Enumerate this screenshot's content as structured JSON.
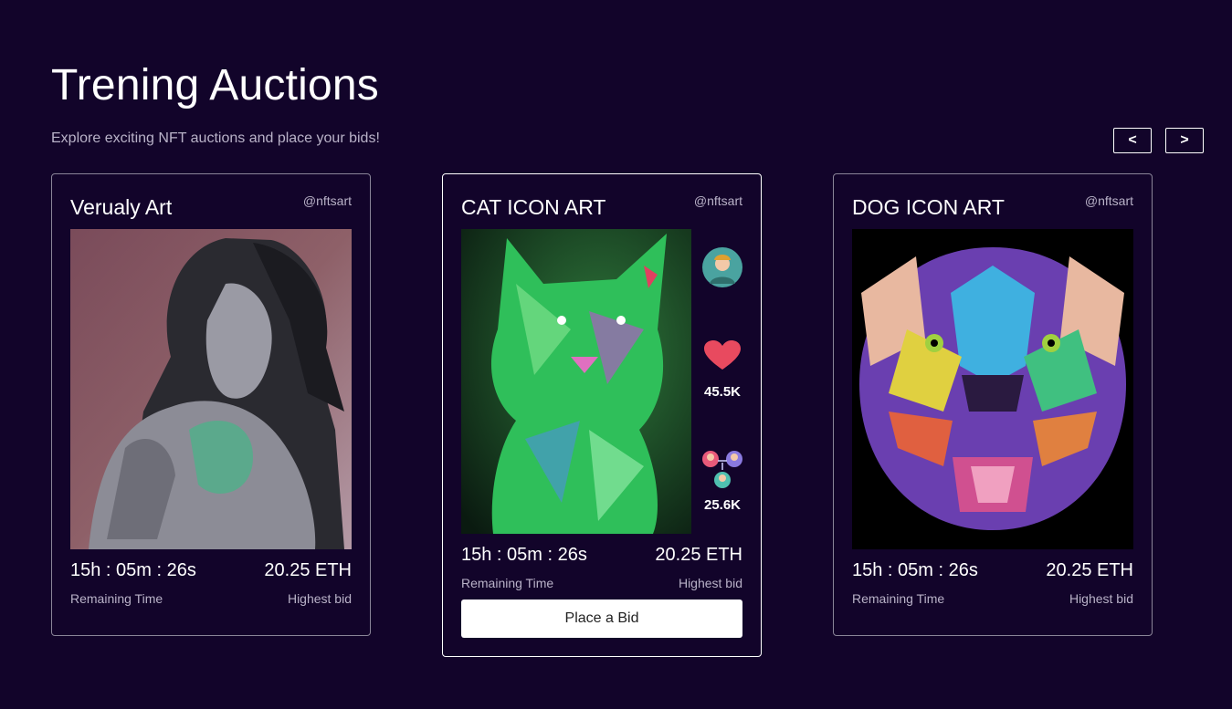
{
  "header": {
    "title": "Trening Auctions",
    "subtitle": "Explore exciting NFT auctions and place your bids!"
  },
  "nav": {
    "prev_label": "<",
    "next_label": ">"
  },
  "cards": [
    {
      "title": "Verualy Art",
      "handle": "@nftsart",
      "time": "15h : 05m : 26s",
      "bid": "20.25 ETH",
      "time_label": "Remaining Time",
      "bid_label": "Highest bid"
    },
    {
      "title": "CAT ICON ART",
      "handle": "@nftsart",
      "time": "15h : 05m : 26s",
      "bid": "20.25 ETH",
      "time_label": "Remaining Time",
      "bid_label": "Highest bid",
      "likes": "45.5K",
      "owners": "25.6K",
      "button": "Place a Bid"
    },
    {
      "title": "DOG ICON ART",
      "handle": "@nftsart",
      "time": "15h : 05m : 26s",
      "bid": "20.25 ETH",
      "time_label": "Remaining Time",
      "bid_label": "Highest bid"
    }
  ],
  "colors": {
    "background": "#12042a",
    "heart": "#e84a5f"
  }
}
